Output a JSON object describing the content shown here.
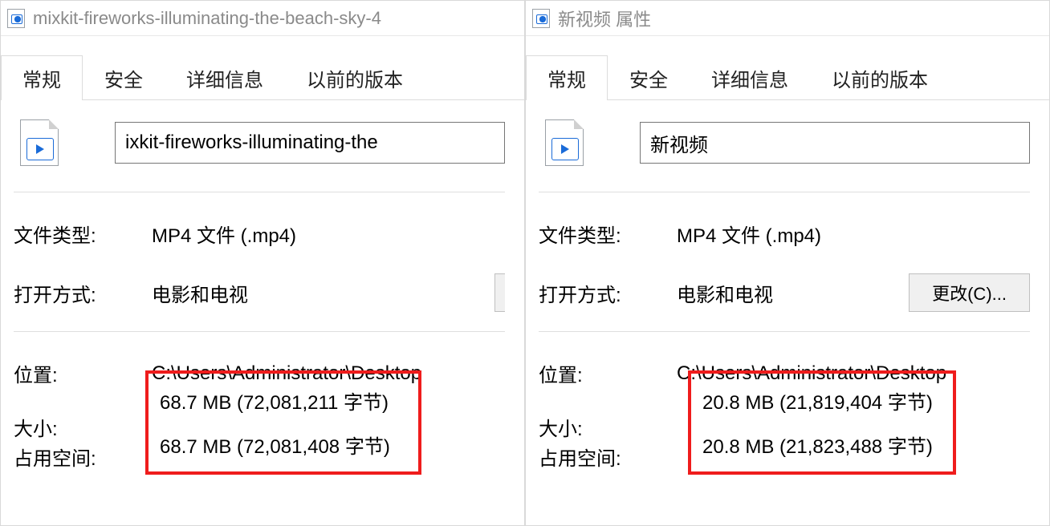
{
  "tabs": {
    "general": "常规",
    "security": "安全",
    "details": "详细信息",
    "previous": "以前的版本"
  },
  "labels": {
    "file_type": "文件类型:",
    "open_with": "打开方式:",
    "location": "位置:",
    "size": "大小:",
    "size_on_disk": "占用空间:",
    "change_button": "更改(C)..."
  },
  "shared": {
    "file_type_value": "MP4 文件 (.mp4)",
    "open_with_value": "电影和电视",
    "location_value_left": "C:\\Users\\Administrator\\Desktop",
    "location_value_right": "C:\\Users\\Administrator\\Desktop"
  },
  "left": {
    "titlebar": "mixkit-fireworks-illuminating-the-beach-sky-4",
    "filename": "ixkit-fireworks-illuminating-the",
    "size": "68.7 MB (72,081,211 字节)",
    "size_on_disk": "68.7 MB (72,081,408 字节)"
  },
  "right": {
    "titlebar": "新视频 属性",
    "filename": "新视频",
    "size": "20.8 MB (21,819,404 字节)",
    "size_on_disk": "20.8 MB (21,823,488 字节)"
  }
}
